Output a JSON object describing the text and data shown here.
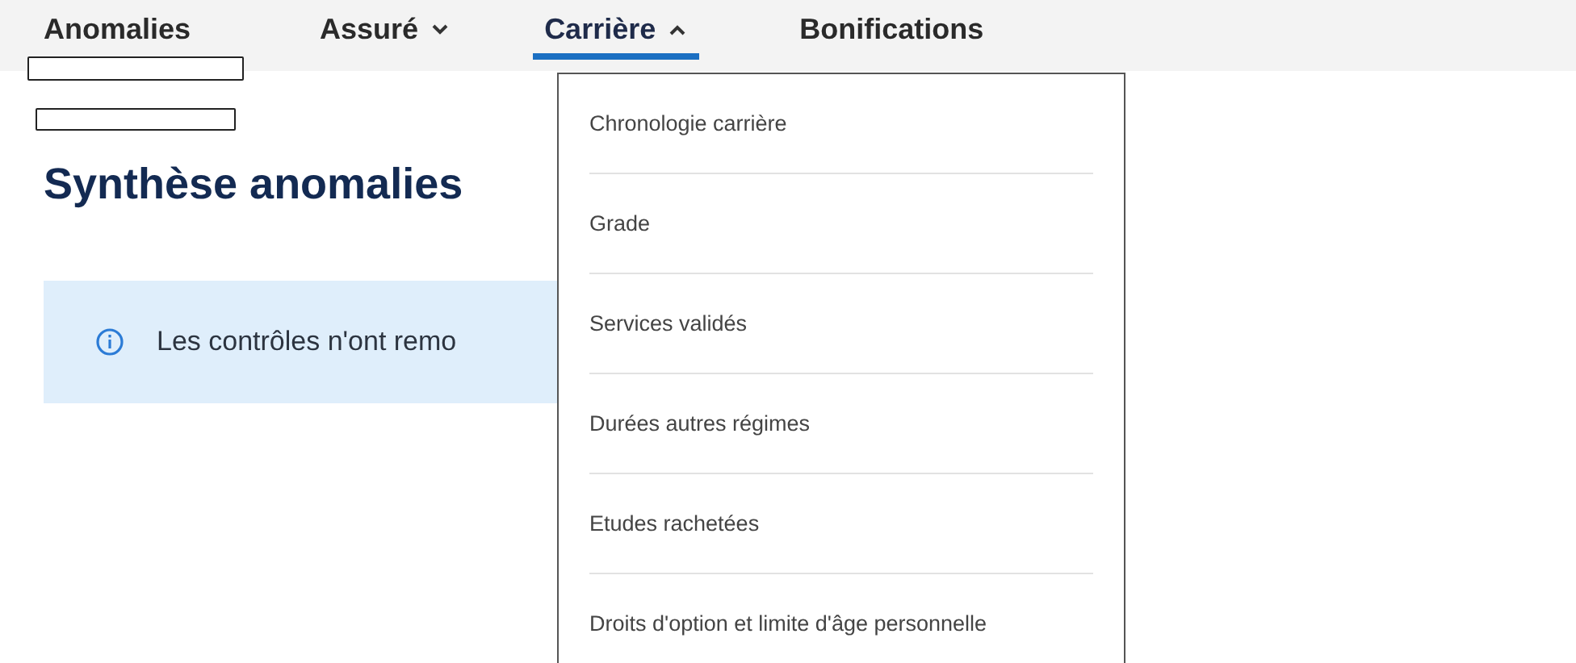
{
  "nav": {
    "items": [
      {
        "label": "Anomalies",
        "kind": "link",
        "selected": false
      },
      {
        "label": "Assuré",
        "kind": "dropdown",
        "expanded": false,
        "selected": false
      },
      {
        "label": "Carrière",
        "kind": "dropdown",
        "expanded": true,
        "selected": true
      },
      {
        "label": "Bonifications",
        "kind": "link",
        "selected": false
      }
    ]
  },
  "page": {
    "title": "Synthèse anomalies",
    "info": {
      "text": "Les contrôles n'ont remo"
    }
  },
  "dropdown": {
    "items": [
      {
        "label": "Chronologie carrière"
      },
      {
        "label": "Grade"
      },
      {
        "label": "Services validés"
      },
      {
        "label": "Durées autres régimes"
      },
      {
        "label": "Etudes rachetées"
      },
      {
        "label": "Droits d'option et limite d'âge personnelle"
      }
    ]
  }
}
